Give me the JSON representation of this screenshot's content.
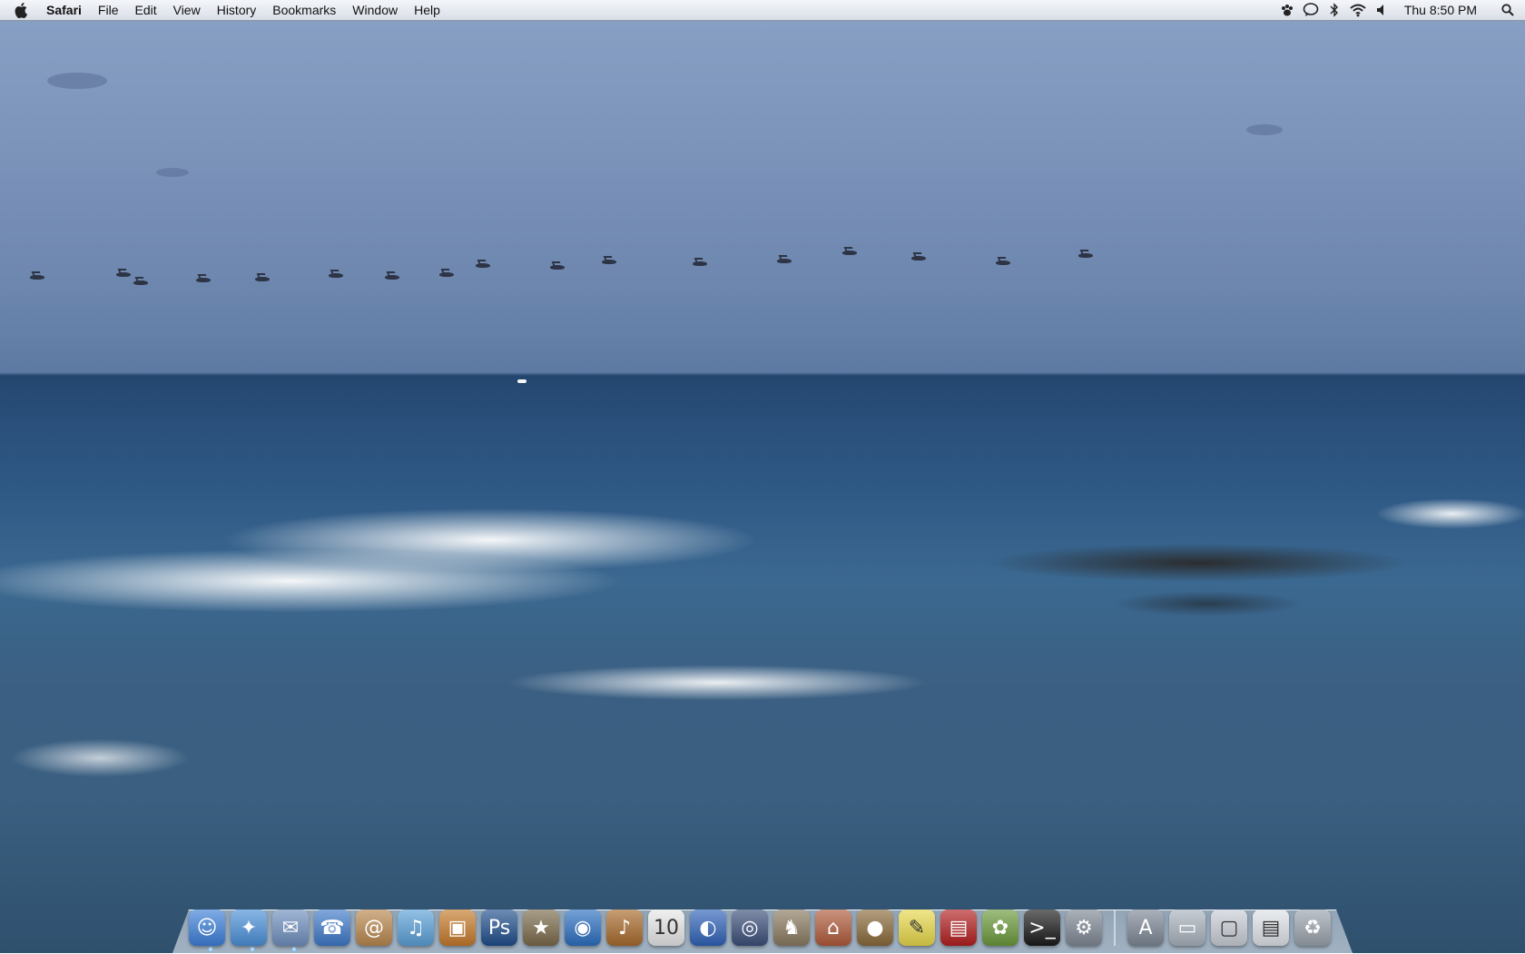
{
  "menubar": {
    "apple_icon": "apple-icon",
    "app_name": "Safari",
    "menus": [
      "File",
      "Edit",
      "View",
      "History",
      "Bookmarks",
      "Window",
      "Help"
    ],
    "status_icons": [
      "growl-paw-icon",
      "chat-bubble-icon",
      "bluetooth-icon",
      "wifi-icon",
      "volume-icon"
    ],
    "clock": "Thu 8:50 PM",
    "spotlight_icon": "search-icon"
  },
  "dock": {
    "apps": [
      {
        "name": "finder",
        "glyph": "☺",
        "color": "#3c7fd9"
      },
      {
        "name": "safari",
        "glyph": "✦",
        "color": "#4a90d9"
      },
      {
        "name": "mail",
        "glyph": "✉",
        "color": "#6f8fbf"
      },
      {
        "name": "ichat",
        "glyph": "☎",
        "color": "#3e79c9"
      },
      {
        "name": "address-book",
        "glyph": "@",
        "color": "#b8874d"
      },
      {
        "name": "itunes",
        "glyph": "♫",
        "color": "#5aa0d8"
      },
      {
        "name": "iphoto",
        "glyph": "▣",
        "color": "#c57a2a"
      },
      {
        "name": "photoshop",
        "glyph": "Ps",
        "color": "#1f4e8c"
      },
      {
        "name": "imovie",
        "glyph": "★",
        "color": "#7a6a4a"
      },
      {
        "name": "dvd-player",
        "glyph": "◉",
        "color": "#2b6fc0"
      },
      {
        "name": "garageband",
        "glyph": "♪",
        "color": "#a86a2b"
      },
      {
        "name": "ical",
        "glyph": "10",
        "color": "#e8e8e8"
      },
      {
        "name": "google-earth",
        "glyph": "◐",
        "color": "#2f62b8"
      },
      {
        "name": "dashboard",
        "glyph": "◎",
        "color": "#3b4f7a"
      },
      {
        "name": "chess",
        "glyph": "♞",
        "color": "#8a7a60"
      },
      {
        "name": "home-app",
        "glyph": "⌂",
        "color": "#b05a3a"
      },
      {
        "name": "growl",
        "glyph": "●",
        "color": "#8a6a3a"
      },
      {
        "name": "stickies",
        "glyph": "✎",
        "color": "#e8d84a"
      },
      {
        "name": "front-row",
        "glyph": "▤",
        "color": "#b31f1f"
      },
      {
        "name": "adium",
        "glyph": "✿",
        "color": "#6a9a3a"
      },
      {
        "name": "terminal",
        "glyph": ">_",
        "color": "#1a1a1a"
      },
      {
        "name": "system-preferences",
        "glyph": "⚙",
        "color": "#7f8894"
      }
    ],
    "stacks": [
      {
        "name": "applications-stack",
        "glyph": "A",
        "color": "#7d8796"
      },
      {
        "name": "documents-stack",
        "glyph": "▭",
        "color": "#a9b2bd"
      },
      {
        "name": "desktop-stack",
        "glyph": "▢",
        "color": "#c9ced6"
      },
      {
        "name": "downloads-stack",
        "glyph": "▤",
        "color": "#dfe3e8"
      },
      {
        "name": "trash",
        "glyph": "♻",
        "color": "#9aa3ad"
      }
    ]
  }
}
